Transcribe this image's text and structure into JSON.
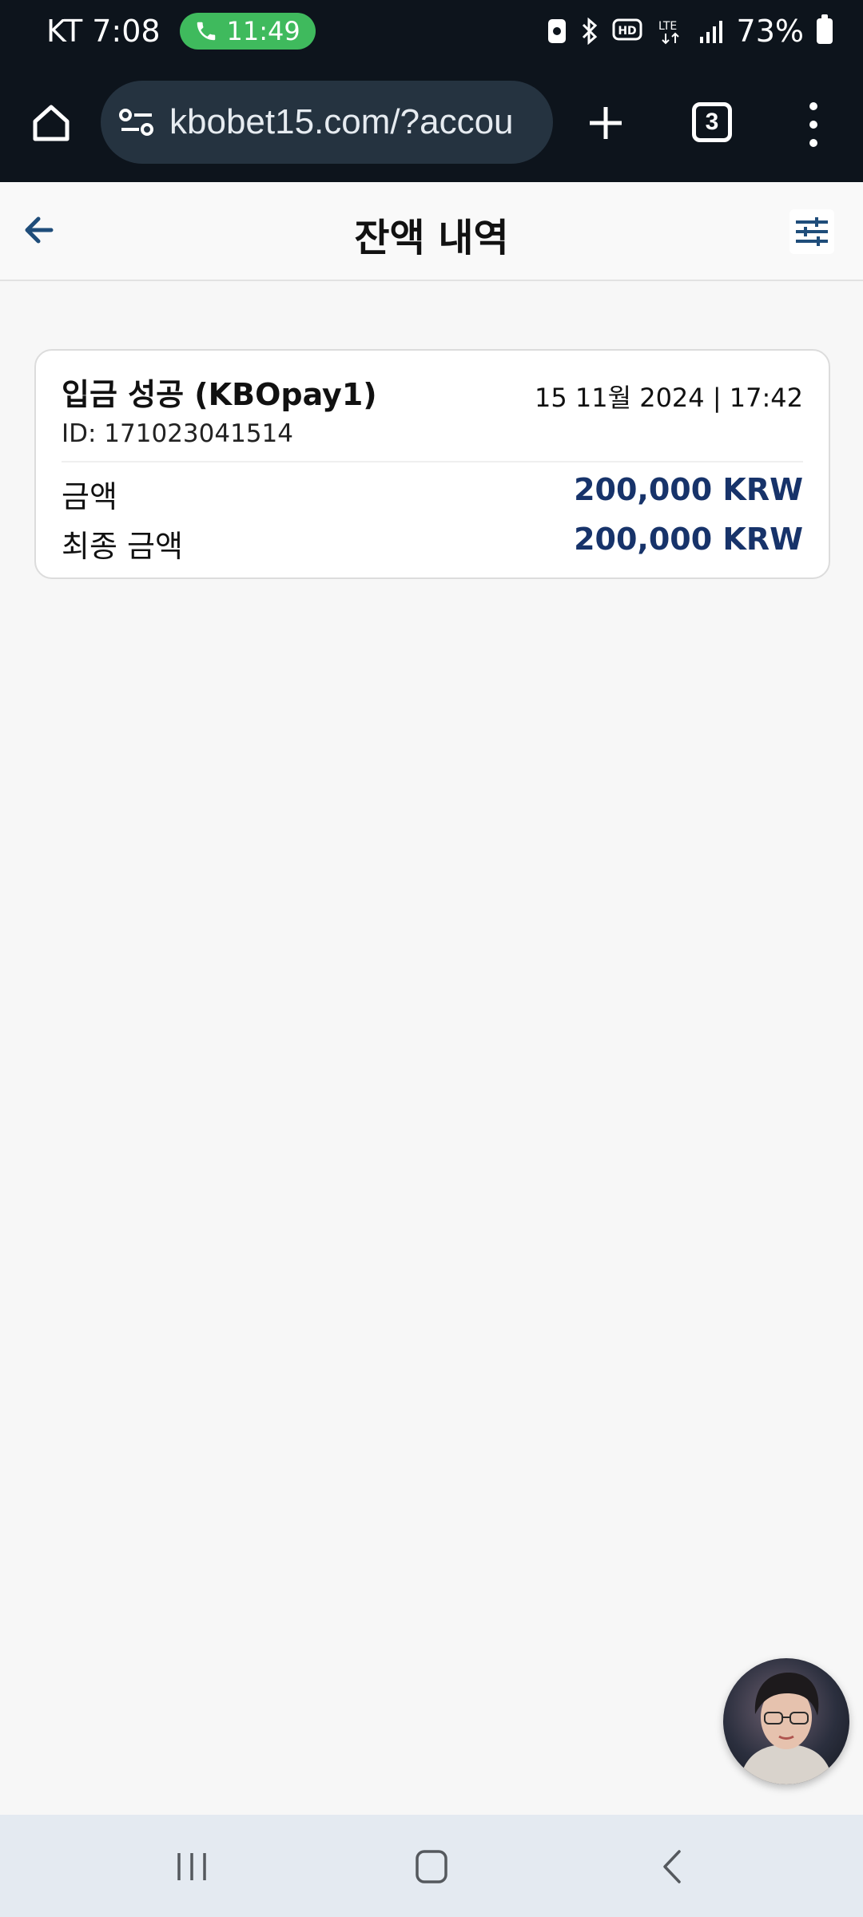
{
  "status_bar": {
    "carrier_time": "KT 7:08",
    "call_duration": "11:49",
    "battery": "73%",
    "indicators": [
      "vibrate-icon",
      "bluetooth-icon",
      "hd-voice-icon",
      "lte-icon",
      "signal-icon",
      "battery-icon"
    ],
    "lte_label": "LTE",
    "hd_label": "HD",
    "call_color": "#3fba5d"
  },
  "browser": {
    "url": "kbobet15.com/?accou",
    "tab_count": "3"
  },
  "header": {
    "title": "잔액 내역"
  },
  "transaction": {
    "title": "입금 성공 (KBOpay1)",
    "date": "15 11월 2024 | 17:42",
    "id": "ID: 171023041514",
    "rows": [
      {
        "label": "금액",
        "value": "200,000 KRW"
      },
      {
        "label": "최종 금액",
        "value": "200,000 KRW"
      }
    ],
    "value_color": "#17336a"
  }
}
